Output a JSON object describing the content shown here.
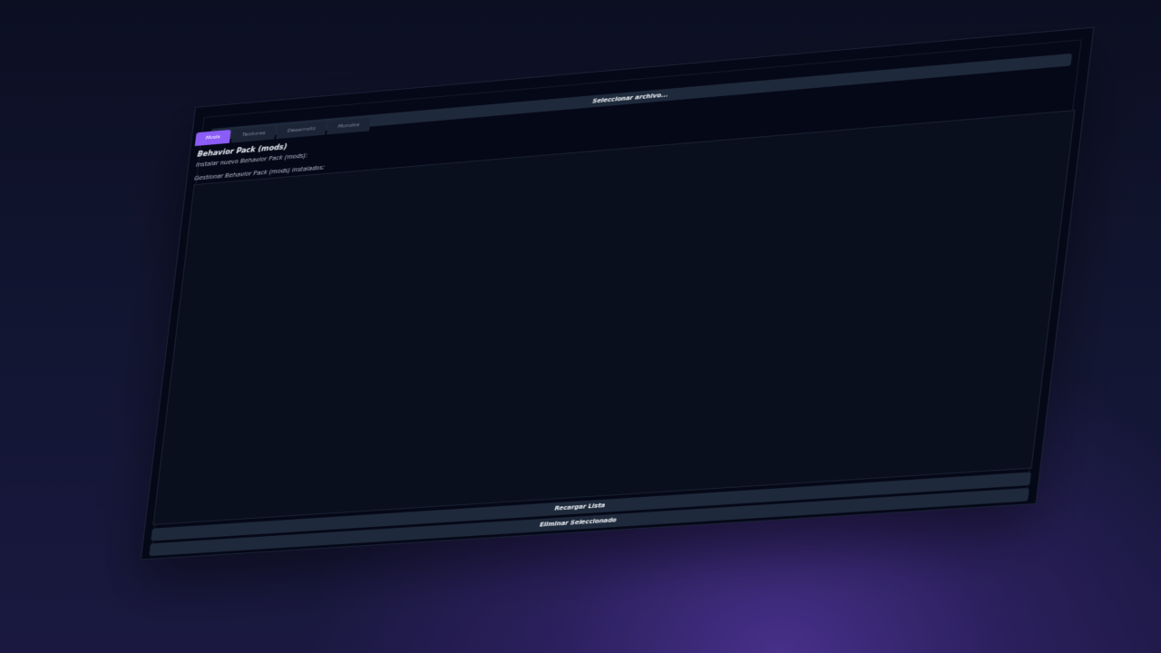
{
  "tabs": [
    {
      "label": "Mods",
      "active": true
    },
    {
      "label": "Texturas",
      "active": false
    },
    {
      "label": "Desarrollo",
      "active": false
    },
    {
      "label": "Mundos",
      "active": false
    }
  ],
  "section": {
    "title": "Behavior Pack (mods)",
    "install_label": "Instalar nuevo Behavior Pack (mods):",
    "select_file_label": "Seleccionar archivo...",
    "manage_label": "Gestionar Behavior Pack (mods) instalados:",
    "reload_label": "Recargar Lista",
    "delete_label": "Eliminar Seleccionado"
  },
  "colors": {
    "accent": "#8b5cf6",
    "button_bg": "#1e293b",
    "window_bg": "#050817",
    "list_bg": "#0a0f1e"
  }
}
